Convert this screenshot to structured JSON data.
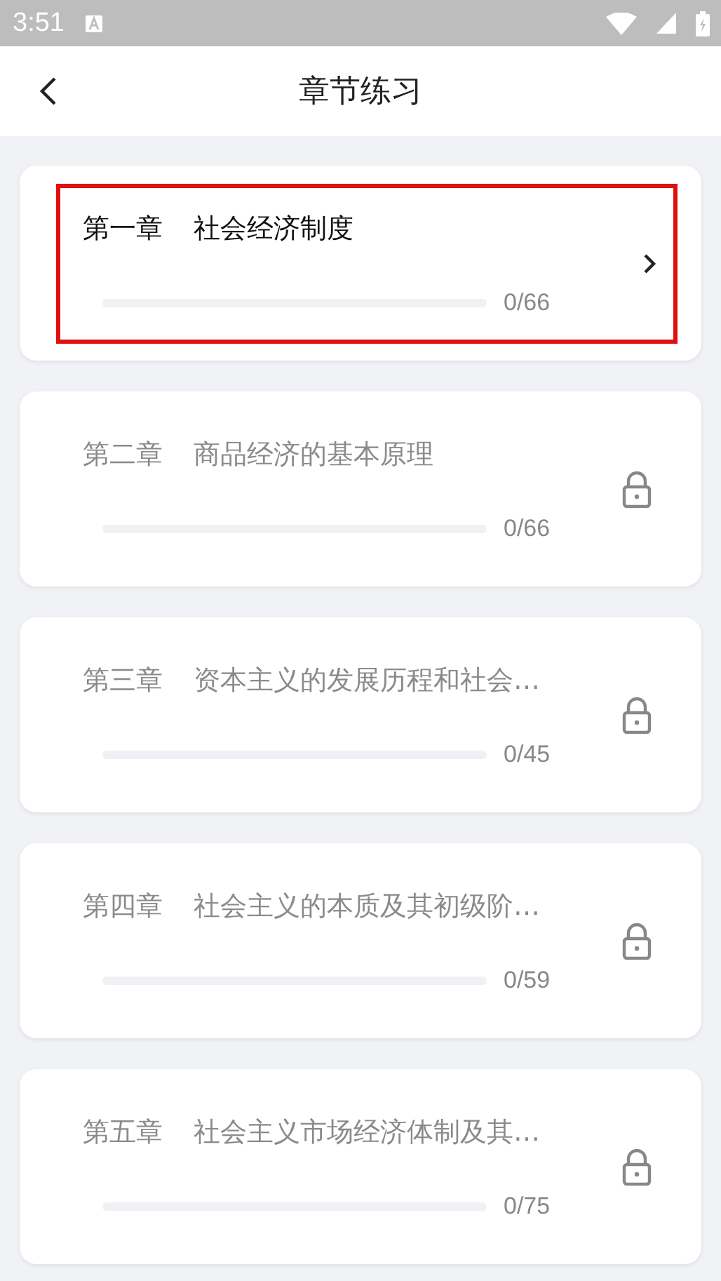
{
  "status_bar": {
    "time": "3:51"
  },
  "header": {
    "title": "章节练习"
  },
  "chapters": [
    {
      "chapter": "第一章",
      "title": "社会经济制度",
      "level": 0,
      "count": "0/66",
      "locked": false,
      "highlighted": true
    },
    {
      "chapter": "第二章",
      "title": "商品经济的基本原理",
      "level": 0,
      "count": "0/66",
      "locked": true,
      "highlighted": false
    },
    {
      "chapter": "第三章",
      "title": "资本主义的发展历程和社会…",
      "level": 0,
      "count": "0/45",
      "locked": true,
      "highlighted": false
    },
    {
      "chapter": "第四章",
      "title": "社会主义的本质及其初级阶…",
      "level": 0,
      "count": "0/59",
      "locked": true,
      "highlighted": false
    },
    {
      "chapter": "第五章",
      "title": "社会主义市场经济体制及其…",
      "level": 0,
      "count": "0/75",
      "locked": true,
      "highlighted": false
    }
  ]
}
